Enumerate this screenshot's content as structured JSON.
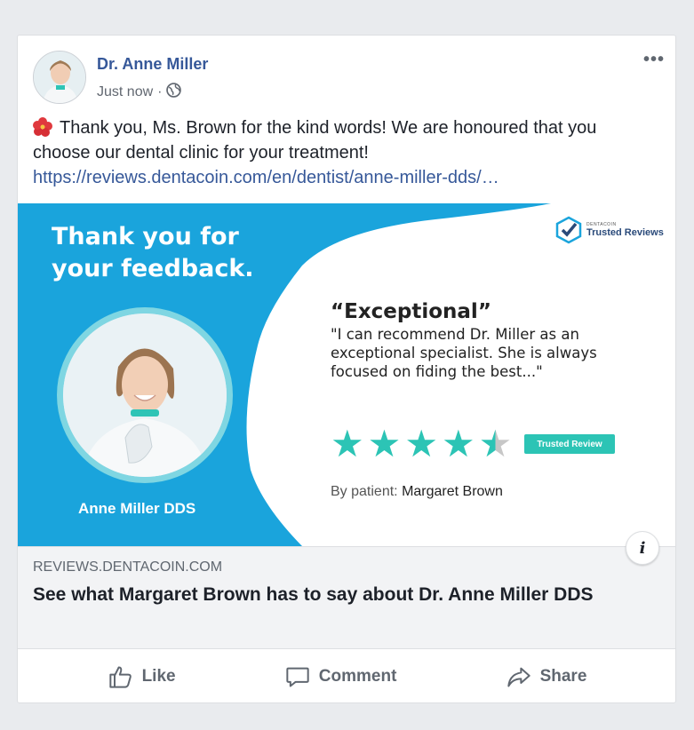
{
  "post": {
    "author": "Dr. Anne Miller",
    "time": "Just now",
    "separator": "·",
    "text": "Thank you, Ms. Brown for the kind words! We are honoured that you choose our dental clinic for your treatment!",
    "link": "https://reviews.dentacoin.com/en/dentist/anne-miller-dds/…",
    "more": "•••"
  },
  "banner": {
    "thank_you": "Thank you for your feedback.",
    "doctor_name": "Anne Miller DDS",
    "logo_small": "DENTACOIN",
    "logo_big": "Trusted Reviews",
    "quote_title": "“Exceptional”",
    "quote_body": "\"I can recommend Dr. Miller as an exceptional specialist. She is always focused on fiding the best...\"",
    "rating": 4.5,
    "badge": "Trusted Review",
    "by_label": "By patient:",
    "by_name": "Margaret Brown",
    "colors": {
      "accent": "#1aa4dc",
      "star": "#2cc4b5"
    }
  },
  "link_preview": {
    "domain": "REVIEWS.DENTACOIN.COM",
    "headline": "See what Margaret Brown has to say about Dr. Anne Miller DDS",
    "info_icon": "i"
  },
  "actions": {
    "like": "Like",
    "comment": "Comment",
    "share": "Share"
  }
}
